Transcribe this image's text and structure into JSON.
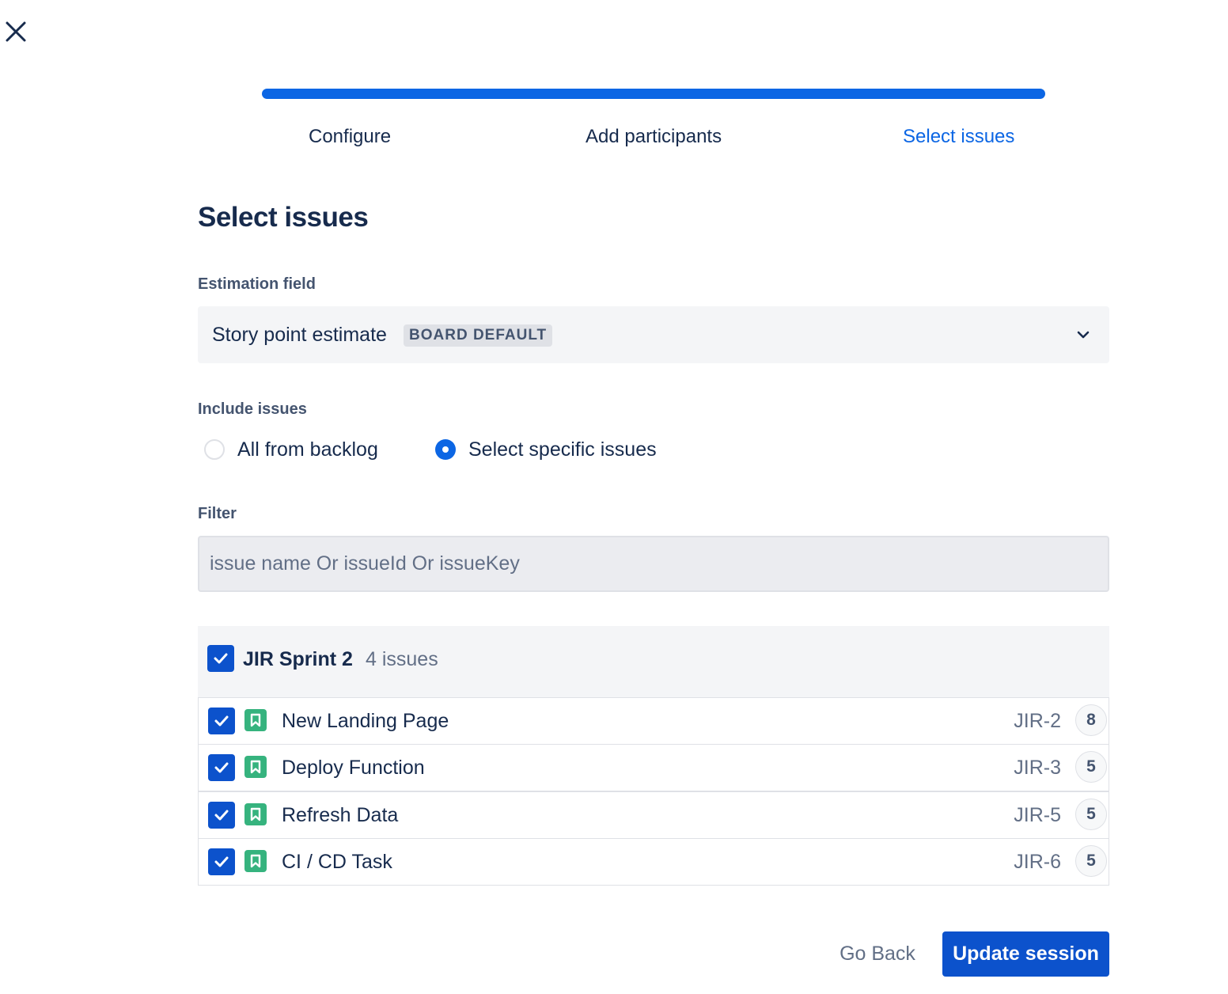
{
  "window": {
    "close_icon": "close-icon"
  },
  "progress": {
    "current_step": 3,
    "total_steps": 3,
    "fill_fraction": 1.0,
    "color": "#0c66e4"
  },
  "steps": [
    {
      "label": "Configure",
      "active": false
    },
    {
      "label": "Add participants",
      "active": false
    },
    {
      "label": "Select issues",
      "active": true
    }
  ],
  "page": {
    "title": "Select issues"
  },
  "estimation": {
    "label": "Estimation field",
    "value": "Story point estimate",
    "badge": "BOARD DEFAULT",
    "chevron_icon": "chevron-down-icon"
  },
  "include": {
    "label": "Include issues",
    "options": [
      {
        "label": "All from backlog",
        "selected": false
      },
      {
        "label": "Select specific issues",
        "selected": true
      }
    ]
  },
  "filter": {
    "label": "Filter",
    "value": "",
    "placeholder": "issue name Or issueId Or issueKey"
  },
  "sprint": {
    "name": "JIR Sprint 2",
    "count": "4 issues",
    "checked": true,
    "issues": [
      {
        "name": "New Landing Page",
        "key": "JIR-2",
        "points": "8",
        "checked": true,
        "type_icon": "story-icon"
      },
      {
        "name": "Deploy Function",
        "key": "JIR-3",
        "points": "5",
        "checked": true,
        "type_icon": "story-icon"
      },
      {
        "name": "Refresh Data",
        "key": "JIR-5",
        "points": "5",
        "checked": true,
        "type_icon": "story-icon"
      },
      {
        "name": "CI / CD Task",
        "key": "JIR-6",
        "points": "5",
        "checked": true,
        "type_icon": "story-icon"
      }
    ]
  },
  "actions": {
    "back_label": "Go Back",
    "submit_label": "Update session"
  },
  "colors": {
    "accent": "#0c66e4",
    "checkbox": "#0c52cc",
    "story": "#36b37e",
    "text": "#172b4d",
    "muted": "#626f86"
  }
}
